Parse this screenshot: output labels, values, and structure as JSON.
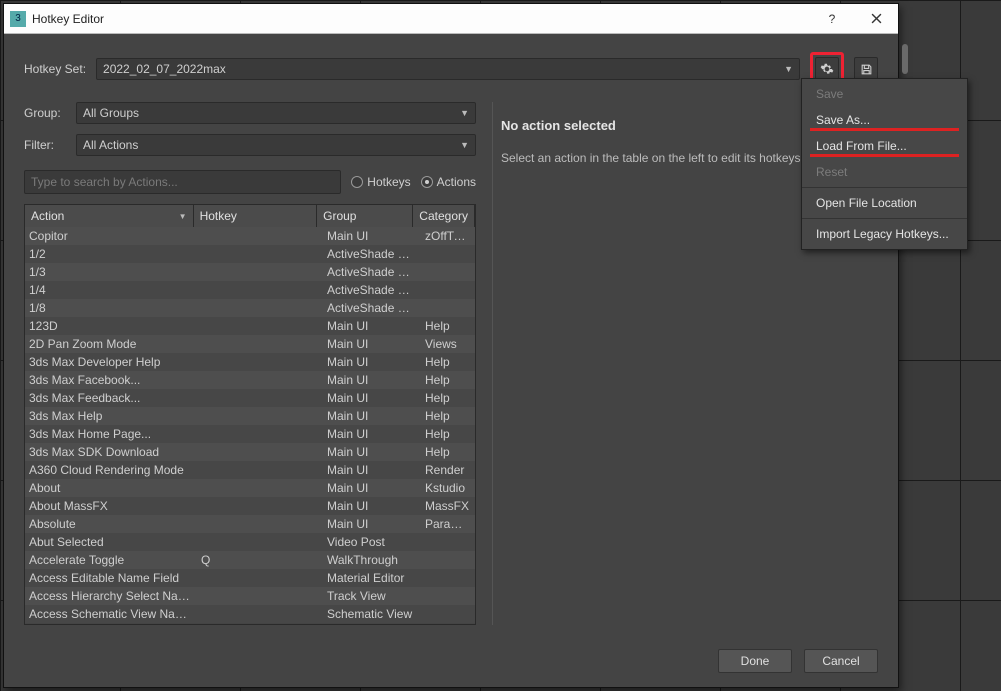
{
  "titlebar": {
    "title": "Hotkey Editor"
  },
  "labels": {
    "hotkey_set": "Hotkey Set:",
    "group": "Group:",
    "filter": "Filter:"
  },
  "hotkey_set_value": "2022_02_07_2022max",
  "group_value": "All Groups",
  "filter_value": "All Actions",
  "search_placeholder": "Type to search by Actions...",
  "radio_hotkeys": "Hotkeys",
  "radio_actions": "Actions",
  "columns": {
    "action": "Action",
    "hotkey": "Hotkey",
    "group": "Group",
    "category": "Category"
  },
  "rows": [
    {
      "action": "Copitor",
      "hotkey": "",
      "group": "Main UI",
      "cat": "zOffTy To"
    },
    {
      "action": "1/2",
      "hotkey": "",
      "group": "ActiveShade Fra...",
      "cat": ""
    },
    {
      "action": "1/3",
      "hotkey": "",
      "group": "ActiveShade Fra...",
      "cat": ""
    },
    {
      "action": "1/4",
      "hotkey": "",
      "group": "ActiveShade Fra...",
      "cat": ""
    },
    {
      "action": "1/8",
      "hotkey": "",
      "group": "ActiveShade Fra...",
      "cat": ""
    },
    {
      "action": "123D",
      "hotkey": "",
      "group": "Main UI",
      "cat": "Help"
    },
    {
      "action": "2D Pan Zoom Mode",
      "hotkey": "",
      "group": "Main UI",
      "cat": "Views"
    },
    {
      "action": "3ds Max Developer Help",
      "hotkey": "",
      "group": "Main UI",
      "cat": "Help"
    },
    {
      "action": "3ds Max Facebook...",
      "hotkey": "",
      "group": "Main UI",
      "cat": "Help"
    },
    {
      "action": "3ds Max Feedback...",
      "hotkey": "",
      "group": "Main UI",
      "cat": "Help"
    },
    {
      "action": "3ds Max Help",
      "hotkey": "",
      "group": "Main UI",
      "cat": "Help"
    },
    {
      "action": "3ds Max Home Page...",
      "hotkey": "",
      "group": "Main UI",
      "cat": "Help"
    },
    {
      "action": "3ds Max SDK Download",
      "hotkey": "",
      "group": "Main UI",
      "cat": "Help"
    },
    {
      "action": "A360 Cloud Rendering Mode",
      "hotkey": "",
      "group": "Main UI",
      "cat": "Render"
    },
    {
      "action": "About",
      "hotkey": "",
      "group": "Main UI",
      "cat": "Kstudio"
    },
    {
      "action": "About MassFX",
      "hotkey": "",
      "group": "Main UI",
      "cat": "MassFX"
    },
    {
      "action": "Absolute",
      "hotkey": "",
      "group": "Main UI",
      "cat": "Parameter"
    },
    {
      "action": "Abut Selected",
      "hotkey": "",
      "group": "Video Post",
      "cat": ""
    },
    {
      "action": "Accelerate Toggle",
      "hotkey": "Q",
      "group": "WalkThrough",
      "cat": ""
    },
    {
      "action": "Access Editable Name Field",
      "hotkey": "",
      "group": "Material Editor",
      "cat": ""
    },
    {
      "action": "Access Hierarchy Select Name Field",
      "hotkey": "",
      "group": "Track View",
      "cat": ""
    },
    {
      "action": "Access Schematic View Name Field",
      "hotkey": "",
      "group": "Schematic View",
      "cat": ""
    }
  ],
  "right": {
    "heading": "No action selected",
    "hint": "Select an action in the table on the left to edit its hotkeys"
  },
  "buttons": {
    "done": "Done",
    "cancel": "Cancel"
  },
  "menu": {
    "save": "Save",
    "save_as": "Save As...",
    "load": "Load From File...",
    "reset": "Reset",
    "open_loc": "Open File Location",
    "import_legacy": "Import Legacy Hotkeys..."
  }
}
